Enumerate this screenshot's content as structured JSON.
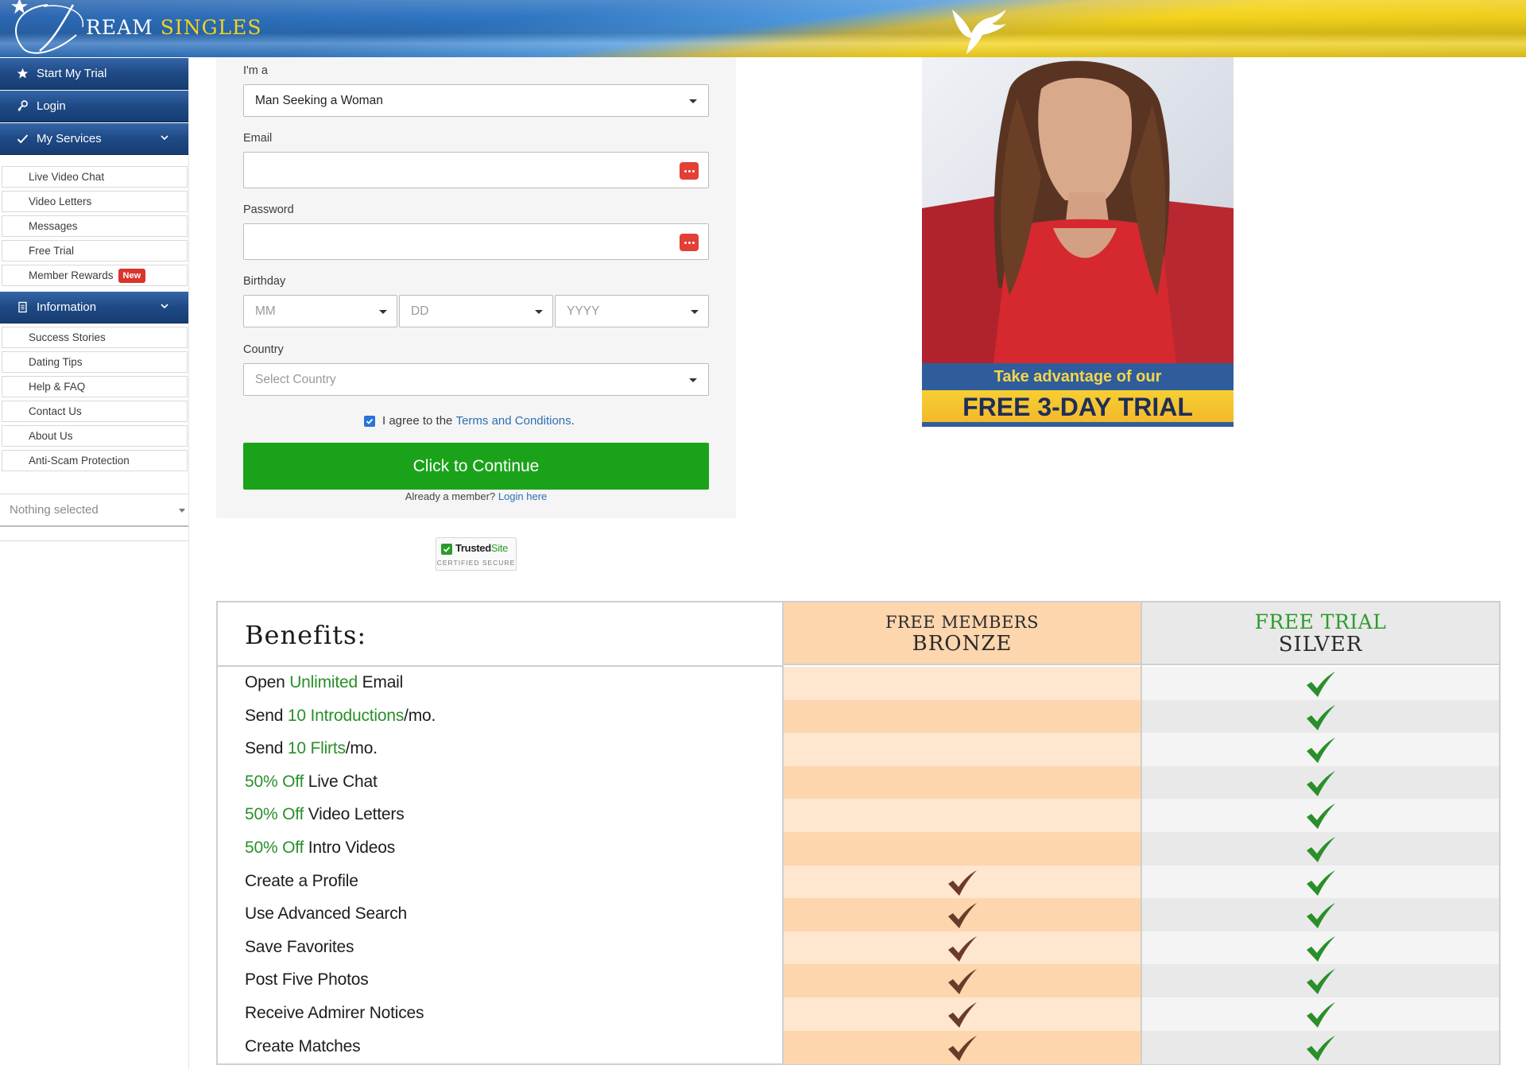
{
  "header": {
    "logo_part1": "REAM",
    "logo_part2": "SINGLES",
    "colors": {
      "flag_blue": "#2f77c4",
      "flag_yellow": "#f4d31b"
    }
  },
  "sidebar": {
    "main_items": [
      {
        "label": "Start My Trial",
        "icon": "star-icon"
      },
      {
        "label": "Login",
        "icon": "key-icon"
      },
      {
        "label": "My Services",
        "icon": "check-icon"
      },
      {
        "label": "Information",
        "icon": "document-icon"
      }
    ],
    "services": [
      "Live Video Chat",
      "Video Letters",
      "Messages",
      "Free Trial",
      "Member Rewards"
    ],
    "new_badge": "New",
    "information": [
      "Success Stories",
      "Dating Tips",
      "Help & FAQ",
      "Contact Us",
      "About Us",
      "Anti-Scam Protection"
    ],
    "language_select": "Nothing selected"
  },
  "form": {
    "im_a_label": "I'm a",
    "im_a_value": "Man Seeking a Woman",
    "email_label": "Email",
    "email_value": "",
    "password_label": "Password",
    "password_value": "",
    "birthday_label": "Birthday",
    "birthday_month": "MM",
    "birthday_day": "DD",
    "birthday_year": "YYYY",
    "country_label": "Country",
    "country_placeholder": "Select Country",
    "agree_text": "I agree to the",
    "terms_link": "Terms and Conditions",
    "terms_period": ".",
    "agree_checked": true,
    "submit_label": "Click to Continue",
    "already_member": "Already a member?",
    "login_link": "Login here",
    "button_color": "#1aa31a"
  },
  "trust_badge": {
    "name_a": "Trusted",
    "name_b": "Site",
    "subtitle": "CERTIFIED SECURE"
  },
  "promo": {
    "line1": "Take advantage of our",
    "line2": "FREE 3-DAY TRIAL"
  },
  "benefits": {
    "title": "Benefits:",
    "bronze_header": [
      "FREE MEMBERS",
      "BRONZE"
    ],
    "silver_header": [
      "FREE TRIAL",
      "SILVER"
    ],
    "rows": [
      {
        "parts": [
          [
            "Open ",
            false
          ],
          [
            "Unlimited",
            true
          ],
          [
            " Email",
            false
          ]
        ],
        "bronze": false,
        "silver": true
      },
      {
        "parts": [
          [
            "Send ",
            false
          ],
          [
            "10 Introductions",
            true
          ],
          [
            "/mo.",
            false
          ]
        ],
        "bronze": false,
        "silver": true
      },
      {
        "parts": [
          [
            "Send ",
            false
          ],
          [
            "10 Flirts",
            true
          ],
          [
            "/mo.",
            false
          ]
        ],
        "bronze": false,
        "silver": true
      },
      {
        "parts": [
          [
            "50% Off",
            true
          ],
          [
            " Live Chat",
            false
          ]
        ],
        "bronze": false,
        "silver": true
      },
      {
        "parts": [
          [
            "50% Off",
            true
          ],
          [
            " Video Letters",
            false
          ]
        ],
        "bronze": false,
        "silver": true
      },
      {
        "parts": [
          [
            "50% Off",
            true
          ],
          [
            " Intro Videos",
            false
          ]
        ],
        "bronze": false,
        "silver": true
      },
      {
        "parts": [
          [
            "Create a Profile",
            false
          ]
        ],
        "bronze": true,
        "silver": true
      },
      {
        "parts": [
          [
            "Use Advanced Search",
            false
          ]
        ],
        "bronze": true,
        "silver": true
      },
      {
        "parts": [
          [
            "Save Favorites",
            false
          ]
        ],
        "bronze": true,
        "silver": true
      },
      {
        "parts": [
          [
            "Post Five Photos",
            false
          ]
        ],
        "bronze": true,
        "silver": true
      },
      {
        "parts": [
          [
            "Receive Admirer Notices",
            false
          ]
        ],
        "bronze": true,
        "silver": true
      },
      {
        "parts": [
          [
            "Create Matches",
            false
          ]
        ],
        "bronze": true,
        "silver": true
      }
    ],
    "colors": {
      "bronze_light": "#fee6cf",
      "bronze_dark": "#fdd6ae",
      "silver_light": "#f4f4f4",
      "silver_dark": "#e9e9e9",
      "green": "#2a8f2a",
      "bronze_check": "#6b3a2a"
    }
  }
}
